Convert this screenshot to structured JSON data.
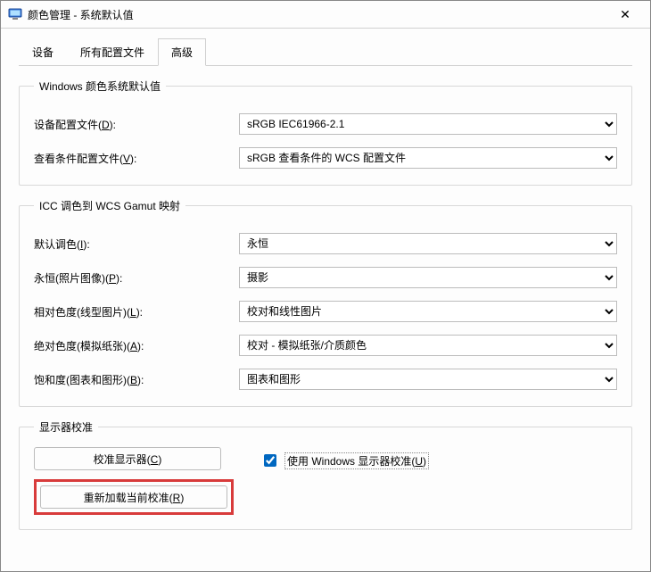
{
  "window": {
    "title": "颜色管理 - 系统默认值"
  },
  "tabs": {
    "items": [
      "设备",
      "所有配置文件",
      "高级"
    ],
    "active_index": 2
  },
  "group_defaults": {
    "legend": "Windows 颜色系统默认值",
    "device_profile": {
      "label_pre": "设备配置文件(",
      "hotkey": "D",
      "label_post": "):",
      "value": "sRGB IEC61966-2.1"
    },
    "viewing_profile": {
      "label_pre": "查看条件配置文件(",
      "hotkey": "V",
      "label_post": "):",
      "value": "sRGB 查看条件的 WCS 配置文件"
    }
  },
  "group_gamut": {
    "legend": "ICC 调色到 WCS Gamut 映射",
    "default_rendering": {
      "label_pre": "默认调色(",
      "hotkey": "I",
      "label_post": "):",
      "value": "永恒"
    },
    "perceptual": {
      "label_pre": "永恒(照片图像)(",
      "hotkey": "P",
      "label_post": "):",
      "value": "摄影"
    },
    "relative": {
      "label_pre": "相对色度(线型图片)(",
      "hotkey": "L",
      "label_post": "):",
      "value": "校对和线性图片"
    },
    "absolute": {
      "label_pre": "绝对色度(模拟纸张)(",
      "hotkey": "A",
      "label_post": "):",
      "value": "校对 - 模拟纸张/介质颜色"
    },
    "saturation": {
      "label_pre": "饱和度(图表和图形)(",
      "hotkey": "B",
      "label_post": "):",
      "value": "图表和图形"
    }
  },
  "group_calib": {
    "legend": "显示器校准",
    "calibrate_btn": {
      "pre": "校准显示器(",
      "hotkey": "C",
      "post": ")"
    },
    "reload_btn": {
      "pre": "重新加载当前校准(",
      "hotkey": "R",
      "post": ")"
    },
    "use_windows": {
      "pre": "使用 Windows 显示器校准(",
      "hotkey": "U",
      "post": ")",
      "checked": true
    }
  }
}
